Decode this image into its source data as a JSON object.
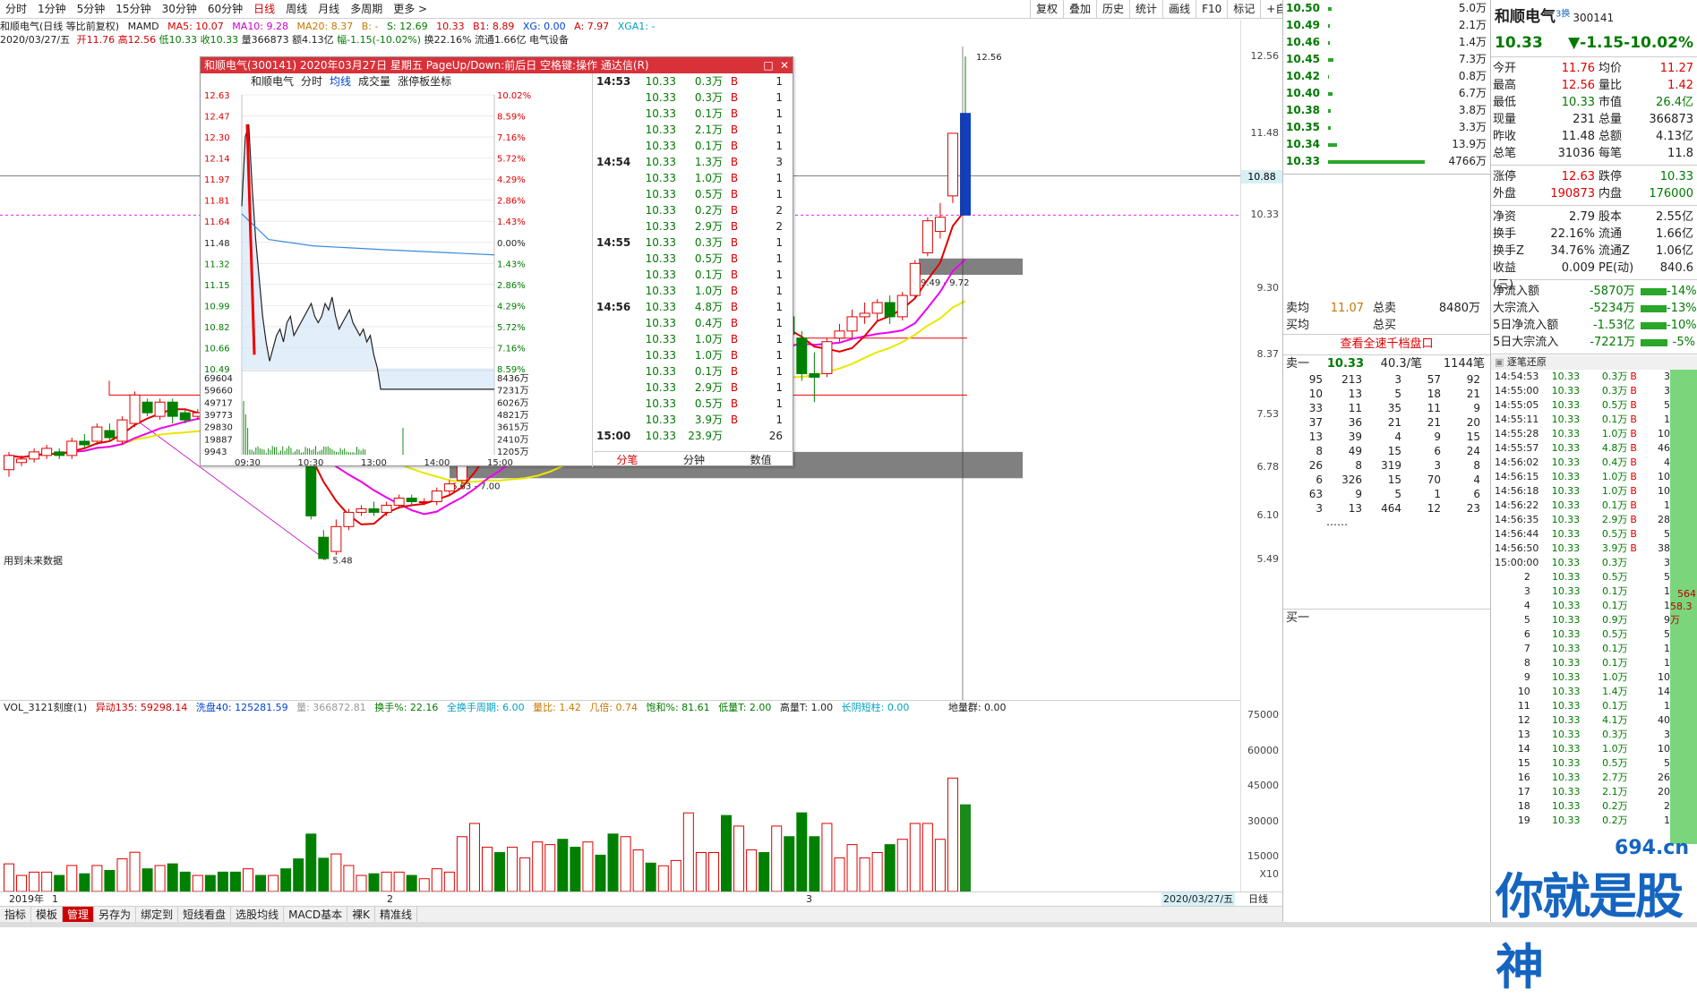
{
  "periods": [
    "分时",
    "1分钟",
    "5分钟",
    "15分钟",
    "30分钟",
    "60分钟",
    "日线",
    "周线",
    "月线",
    "多周期",
    "更多 >"
  ],
  "active_period": "日线",
  "tools": [
    "复权",
    "叠加",
    "历史",
    "统计",
    "画线",
    "F10",
    "标记",
    "+自选",
    "返回"
  ],
  "info": {
    "title": "和顺电气(日线 等比前复权)",
    "mamd": "MAMD",
    "ma5": "MA5: 10.07",
    "ma10": "MA10: 9.28",
    "ma20": "MA20: 8.37",
    "b_val": "B: -",
    "s_val": "S: 12.69",
    "sep": "10.33",
    "b1": "B1: 8.89",
    "xg": "XG: 0.00",
    "a": "A: 7.97",
    "xga1": "XGA1: -",
    "line2": "2020/03/27/五",
    "open": "开11.76",
    "high": "高12.56",
    "low": "低10.33",
    "close": "收10.33",
    "vol": "量366873",
    "amount": "额4.13亿",
    "pct": "幅-1.15(-10.02%)",
    "turnover": "换22.16%",
    "float": "流通1.66亿",
    "sector": "电气设备",
    "future_note": "用到未来数据"
  },
  "price_axis": [
    "12.56",
    "11.48",
    "10.88",
    "10.33",
    "9.30",
    "8.37",
    "7.53",
    "6.78",
    "6.10",
    "5.49"
  ],
  "kline_labels": {
    "high_mark": "12.56",
    "low_mark": "5.48",
    "zone1": "6.63 - 7.00",
    "zone2": "9.49 - 9.72"
  },
  "vol_header": {
    "name": "VOL_3121刻度(1)",
    "yidong": "异动135: 59298.14",
    "xipan": "洗盘40: 125281.59",
    "liang": "量: 366872.81",
    "huanshou": "换手%: 22.16",
    "quanzhou": "全换手周期: 6.00",
    "liangbi": "量比: 1.42",
    "jiliang": "几倍: 0.74",
    "baohe": "饱和%: 81.61",
    "dilian": "低量T: 2.00",
    "gaoliang": "高量T: 1.00",
    "changyin": "长阴短柱: 0.00",
    "diliangqun": "地量群: 0.00"
  },
  "vol_axis": [
    "75000",
    "60000",
    "45000",
    "30000",
    "15000",
    "X10"
  ],
  "date_bar": {
    "year": "2019年",
    "m1": "1",
    "m2": "2",
    "m3": "3",
    "current": "2020/03/27/五",
    "period": "日线"
  },
  "bottom_tabs": [
    "指标",
    "模板",
    "管理",
    "另存为",
    "绑定到",
    "短线看盘",
    "选股均线",
    "MACD基本",
    "裸K",
    "精准线"
  ],
  "active_bottom_tab": "管理",
  "popup": {
    "title": "和顺电气(300141) 2020年03月27日 星期五 PageUp/Down:前后日 空格键:操作 通达信(R)",
    "sub": [
      "和顺电气",
      "分时",
      "均线",
      "成交量",
      "涨停板坐标"
    ],
    "price_left": [
      "12.63",
      "12.47",
      "12.30",
      "12.14",
      "11.97",
      "11.81",
      "11.64",
      "11.48",
      "11.32",
      "11.15",
      "10.99",
      "10.82",
      "10.66",
      "10.49"
    ],
    "pct_right": [
      "10.02%",
      "8.59%",
      "7.16%",
      "5.72%",
      "4.29%",
      "2.86%",
      "1.43%",
      "0.00%",
      "1.43%",
      "2.86%",
      "4.29%",
      "5.72%",
      "7.16%",
      "8.59%"
    ],
    "vol_left": [
      "69604",
      "59660",
      "49717",
      "39773",
      "29830",
      "19887",
      "9943"
    ],
    "vol_right": [
      "8436万",
      "7231万",
      "6026万",
      "4821万",
      "3615万",
      "2410万",
      "1205万"
    ],
    "times": [
      "09:30",
      "10:30",
      "13:00",
      "14:00",
      "15:00"
    ],
    "trades": [
      {
        "t": "14:53",
        "p": "10.33",
        "v": "0.3万",
        "d": "B",
        "n": "1"
      },
      {
        "t": "",
        "p": "10.33",
        "v": "0.3万",
        "d": "B",
        "n": "1"
      },
      {
        "t": "",
        "p": "10.33",
        "v": "0.1万",
        "d": "B",
        "n": "1"
      },
      {
        "t": "",
        "p": "10.33",
        "v": "2.1万",
        "d": "B",
        "n": "1"
      },
      {
        "t": "",
        "p": "10.33",
        "v": "0.1万",
        "d": "B",
        "n": "1"
      },
      {
        "t": "14:54",
        "p": "10.33",
        "v": "1.3万",
        "d": "B",
        "n": "3"
      },
      {
        "t": "",
        "p": "10.33",
        "v": "1.0万",
        "d": "B",
        "n": "1"
      },
      {
        "t": "",
        "p": "10.33",
        "v": "0.5万",
        "d": "B",
        "n": "1"
      },
      {
        "t": "",
        "p": "10.33",
        "v": "0.2万",
        "d": "B",
        "n": "2"
      },
      {
        "t": "",
        "p": "10.33",
        "v": "2.9万",
        "d": "B",
        "n": "2"
      },
      {
        "t": "14:55",
        "p": "10.33",
        "v": "0.3万",
        "d": "B",
        "n": "1"
      },
      {
        "t": "",
        "p": "10.33",
        "v": "0.5万",
        "d": "B",
        "n": "1"
      },
      {
        "t": "",
        "p": "10.33",
        "v": "0.1万",
        "d": "B",
        "n": "1"
      },
      {
        "t": "",
        "p": "10.33",
        "v": "1.0万",
        "d": "B",
        "n": "1"
      },
      {
        "t": "14:56",
        "p": "10.33",
        "v": "4.8万",
        "d": "B",
        "n": "1"
      },
      {
        "t": "",
        "p": "10.33",
        "v": "0.4万",
        "d": "B",
        "n": "1"
      },
      {
        "t": "",
        "p": "10.33",
        "v": "1.0万",
        "d": "B",
        "n": "1"
      },
      {
        "t": "",
        "p": "10.33",
        "v": "1.0万",
        "d": "B",
        "n": "1"
      },
      {
        "t": "",
        "p": "10.33",
        "v": "0.1万",
        "d": "B",
        "n": "1"
      },
      {
        "t": "",
        "p": "10.33",
        "v": "2.9万",
        "d": "B",
        "n": "1"
      },
      {
        "t": "",
        "p": "10.33",
        "v": "0.5万",
        "d": "B",
        "n": "1"
      },
      {
        "t": "",
        "p": "10.33",
        "v": "3.9万",
        "d": "B",
        "n": "1"
      },
      {
        "t": "15:00",
        "p": "10.33",
        "v": "23.9万",
        "d": "",
        "n": "26"
      }
    ],
    "tabs": [
      "分笔",
      "分钟",
      "数值"
    ]
  },
  "order_book": [
    {
      "p": "10.50",
      "v": "5.0万",
      "w": 4
    },
    {
      "p": "10.49",
      "v": "2.1万",
      "w": 2
    },
    {
      "p": "10.46",
      "v": "1.4万",
      "w": 2
    },
    {
      "p": "10.45",
      "v": "7.3万",
      "w": 6
    },
    {
      "p": "10.42",
      "v": "0.8万",
      "w": 1
    },
    {
      "p": "10.40",
      "v": "6.7万",
      "w": 5
    },
    {
      "p": "10.38",
      "v": "3.8万",
      "w": 3
    },
    {
      "p": "10.35",
      "v": "3.3万",
      "w": 3
    },
    {
      "p": "10.34",
      "v": "13.9万",
      "w": 10
    },
    {
      "p": "10.33",
      "v": "4766万",
      "w": 108
    }
  ],
  "ob_mid": {
    "mj_k": "卖均",
    "mj_v": "11.07",
    "zm_k": "总卖",
    "zm_v": "8480万",
    "bj_k": "买均",
    "zb_k": "总买"
  },
  "link": "查看全速千档盘口",
  "sell1": {
    "k": "卖一",
    "p": "10.33",
    "v": "40.3/笔",
    "n": "1144笔"
  },
  "book_grid": [
    [
      "95",
      "213",
      "3",
      "57",
      "92"
    ],
    [
      "10",
      "13",
      "5",
      "18",
      "21"
    ],
    [
      "33",
      "11",
      "35",
      "11",
      "9"
    ],
    [
      "37",
      "36",
      "21",
      "21",
      "20"
    ],
    [
      "13",
      "39",
      "4",
      "9",
      "15"
    ],
    [
      "8",
      "49",
      "15",
      "6",
      "24"
    ],
    [
      "26",
      "8",
      "319",
      "3",
      "8"
    ],
    [
      "6",
      "326",
      "15",
      "70",
      "4"
    ],
    [
      "63",
      "9",
      "5",
      "1",
      "6"
    ],
    [
      "3",
      "13",
      "464",
      "12",
      "23"
    ]
  ],
  "book_more": "……",
  "buy1": "买一",
  "stock": {
    "name": "和顺电气",
    "code": "300141",
    "tag": "3换",
    "price": "10.33",
    "change": "▼-1.15-10.02%"
  },
  "stats": [
    [
      "今开",
      "11.76",
      "均价",
      "11.27"
    ],
    [
      "最高",
      "12.56",
      "量比",
      "1.42"
    ],
    [
      "最低",
      "10.33",
      "市值",
      "26.4亿"
    ],
    [
      "现量",
      "231",
      "总量",
      "366873"
    ],
    [
      "昨收",
      "11.48",
      "总额",
      "4.13亿"
    ],
    [
      "总笔",
      "31036",
      "每笔",
      "11.8"
    ]
  ],
  "stats2": [
    [
      "涨停",
      "12.63",
      "跌停",
      "10.33"
    ],
    [
      "外盘",
      "190873",
      "内盘",
      "176000"
    ]
  ],
  "stats3": [
    [
      "净资",
      "2.79",
      "股本",
      "2.55亿"
    ],
    [
      "换手",
      "22.16%",
      "流通",
      "1.66亿"
    ],
    [
      "换手Z",
      "34.76%",
      "流通Z",
      "1.06亿"
    ],
    [
      "收益(三)",
      "0.009",
      "PE(动)",
      "840.6"
    ]
  ],
  "flows": [
    {
      "k": "净流入额",
      "v": "-5870万",
      "p": "-14%"
    },
    {
      "k": "大宗流入",
      "v": "-5234万",
      "p": "-13%"
    },
    {
      "k": "5日净流入额",
      "v": "-1.53亿",
      "p": "-10%"
    },
    {
      "k": "5日大宗流入",
      "v": "-7221万",
      "p": "-5%"
    }
  ],
  "tick_title": "逐笔还原",
  "ticks": [
    {
      "t": "14:54:53",
      "p": "10.33",
      "v": "0.3万",
      "d": "B",
      "n": "3"
    },
    {
      "t": "14:55:00",
      "p": "10.33",
      "v": "0.3万",
      "d": "B",
      "n": "3"
    },
    {
      "t": "14:55:05",
      "p": "10.33",
      "v": "0.5万",
      "d": "B",
      "n": "5"
    },
    {
      "t": "14:55:11",
      "p": "10.33",
      "v": "0.1万",
      "d": "B",
      "n": "1"
    },
    {
      "t": "14:55:28",
      "p": "10.33",
      "v": "1.0万",
      "d": "B",
      "n": "10"
    },
    {
      "t": "14:55:57",
      "p": "10.33",
      "v": "4.8万",
      "d": "B",
      "n": "46"
    },
    {
      "t": "14:56:02",
      "p": "10.33",
      "v": "0.4万",
      "d": "B",
      "n": "4"
    },
    {
      "t": "14:56:15",
      "p": "10.33",
      "v": "1.0万",
      "d": "B",
      "n": "10"
    },
    {
      "t": "14:56:18",
      "p": "10.33",
      "v": "1.0万",
      "d": "B",
      "n": "10"
    },
    {
      "t": "14:56:22",
      "p": "10.33",
      "v": "0.1万",
      "d": "B",
      "n": "1"
    },
    {
      "t": "14:56:35",
      "p": "10.33",
      "v": "2.9万",
      "d": "B",
      "n": "28"
    },
    {
      "t": "14:56:44",
      "p": "10.33",
      "v": "0.5万",
      "d": "B",
      "n": "5"
    },
    {
      "t": "14:56:50",
      "p": "10.33",
      "v": "3.9万",
      "d": "B",
      "n": "38"
    },
    {
      "t": "15:00:00",
      "p": "10.33",
      "v": "0.3万",
      "d": "",
      "n": "3"
    },
    {
      "t": "2",
      "p": "10.33",
      "v": "0.5万",
      "d": "",
      "n": "5"
    },
    {
      "t": "3",
      "p": "10.33",
      "v": "0.1万",
      "d": "",
      "n": "1"
    },
    {
      "t": "4",
      "p": "10.33",
      "v": "0.1万",
      "d": "",
      "n": "1"
    },
    {
      "t": "5",
      "p": "10.33",
      "v": "0.9万",
      "d": "",
      "n": "9"
    },
    {
      "t": "6",
      "p": "10.33",
      "v": "0.5万",
      "d": "",
      "n": "5"
    },
    {
      "t": "7",
      "p": "10.33",
      "v": "0.1万",
      "d": "",
      "n": "1"
    },
    {
      "t": "8",
      "p": "10.33",
      "v": "0.1万",
      "d": "",
      "n": "1"
    },
    {
      "t": "9",
      "p": "10.33",
      "v": "1.0万",
      "d": "",
      "n": "10"
    },
    {
      "t": "10",
      "p": "10.33",
      "v": "1.4万",
      "d": "",
      "n": "14"
    },
    {
      "t": "11",
      "p": "10.33",
      "v": "0.1万",
      "d": "",
      "n": "1"
    },
    {
      "t": "12",
      "p": "10.33",
      "v": "4.1万",
      "d": "",
      "n": "40"
    },
    {
      "t": "13",
      "p": "10.33",
      "v": "0.3万",
      "d": "",
      "n": "3"
    },
    {
      "t": "14",
      "p": "10.33",
      "v": "1.0万",
      "d": "",
      "n": "10"
    },
    {
      "t": "15",
      "p": "10.33",
      "v": "0.5万",
      "d": "",
      "n": "5"
    },
    {
      "t": "16",
      "p": "10.33",
      "v": "2.7万",
      "d": "",
      "n": "26"
    },
    {
      "t": "17",
      "p": "10.33",
      "v": "2.1万",
      "d": "",
      "n": "20"
    },
    {
      "t": "18",
      "p": "10.33",
      "v": "0.2万",
      "d": "",
      "n": "2"
    },
    {
      "t": "19",
      "p": "10.33",
      "v": "0.2万",
      "d": "",
      "n": "1"
    }
  ],
  "side_bar": {
    "n1": "564",
    "n2": "58.3万"
  },
  "watermark": {
    "small": "694.cn",
    "big": "你就是股神"
  },
  "colors": {
    "up": "#e00000",
    "down": "#008000",
    "ma5": "#e00000",
    "ma10": "#ee00ee",
    "ma20": "#e8e800",
    "accent": "#d9313a"
  },
  "chart_data": {
    "type": "candlestick",
    "title": "和顺电气(日线 等比前复权)",
    "ylim": [
      5.4,
      12.7
    ],
    "candles": [
      {
        "o": 6.75,
        "c": 6.95,
        "h": 7.0,
        "l": 6.65
      },
      {
        "o": 6.85,
        "c": 6.9,
        "h": 6.95,
        "l": 6.8
      },
      {
        "o": 6.9,
        "c": 7.0,
        "h": 7.05,
        "l": 6.85
      },
      {
        "o": 6.95,
        "c": 7.05,
        "h": 7.1,
        "l": 6.9
      },
      {
        "o": 7.0,
        "c": 6.95,
        "h": 7.05,
        "l": 6.9
      },
      {
        "o": 6.95,
        "c": 7.15,
        "h": 7.2,
        "l": 6.9
      },
      {
        "o": 7.15,
        "c": 7.1,
        "h": 7.25,
        "l": 7.05
      },
      {
        "o": 7.15,
        "c": 7.35,
        "h": 7.4,
        "l": 7.1
      },
      {
        "o": 7.3,
        "c": 7.2,
        "h": 7.4,
        "l": 7.15
      },
      {
        "o": 7.15,
        "c": 7.45,
        "h": 7.5,
        "l": 7.1
      },
      {
        "o": 7.4,
        "c": 7.8,
        "h": 7.85,
        "l": 7.35
      },
      {
        "o": 7.7,
        "c": 7.55,
        "h": 7.75,
        "l": 7.5
      },
      {
        "o": 7.5,
        "c": 7.7,
        "h": 7.75,
        "l": 7.45
      },
      {
        "o": 7.7,
        "c": 7.5,
        "h": 7.75,
        "l": 7.4
      },
      {
        "o": 7.55,
        "c": 7.45,
        "h": 7.6,
        "l": 7.4
      },
      {
        "o": 7.5,
        "c": 7.55,
        "h": 7.6,
        "l": 7.45
      },
      {
        "o": 7.45,
        "c": 7.4,
        "h": 7.5,
        "l": 7.35
      },
      {
        "o": 7.4,
        "c": 7.3,
        "h": 7.45,
        "l": 7.25
      },
      {
        "o": 7.3,
        "c": 7.2,
        "h": 7.35,
        "l": 7.15
      },
      {
        "o": 7.2,
        "c": 7.35,
        "h": 7.4,
        "l": 7.15
      },
      {
        "o": 7.3,
        "c": 7.25,
        "h": 7.35,
        "l": 7.2
      },
      {
        "o": 7.25,
        "c": 7.3,
        "h": 7.35,
        "l": 7.2
      },
      {
        "o": 7.3,
        "c": 7.15,
        "h": 7.35,
        "l": 7.1
      },
      {
        "o": 7.15,
        "c": 6.85,
        "h": 7.2,
        "l": 6.8
      },
      {
        "o": 6.8,
        "c": 6.1,
        "h": 6.8,
        "l": 6.05
      },
      {
        "o": 5.8,
        "c": 5.5,
        "h": 5.9,
        "l": 5.48
      },
      {
        "o": 5.6,
        "c": 5.95,
        "h": 6.05,
        "l": 5.55
      },
      {
        "o": 5.95,
        "c": 6.15,
        "h": 6.2,
        "l": 5.9
      },
      {
        "o": 6.15,
        "c": 6.2,
        "h": 6.25,
        "l": 6.1
      },
      {
        "o": 6.2,
        "c": 6.15,
        "h": 6.3,
        "l": 6.1
      },
      {
        "o": 6.15,
        "c": 6.25,
        "h": 6.3,
        "l": 6.1
      },
      {
        "o": 6.25,
        "c": 6.35,
        "h": 6.4,
        "l": 6.2
      },
      {
        "o": 6.35,
        "c": 6.3,
        "h": 6.4,
        "l": 6.25
      },
      {
        "o": 6.3,
        "c": 6.3,
        "h": 6.35,
        "l": 6.25
      },
      {
        "o": 6.3,
        "c": 6.45,
        "h": 6.5,
        "l": 6.25
      },
      {
        "o": 6.45,
        "c": 6.55,
        "h": 6.6,
        "l": 6.4
      },
      {
        "o": 6.6,
        "c": 6.9,
        "h": 7.0,
        "l": 6.55
      },
      {
        "o": 6.9,
        "c": 7.35,
        "h": 7.4,
        "l": 6.85
      },
      {
        "o": 7.4,
        "c": 7.6,
        "h": 7.65,
        "l": 7.3
      },
      {
        "o": 7.45,
        "c": 7.3,
        "h": 7.55,
        "l": 7.25
      },
      {
        "o": 7.4,
        "c": 7.6,
        "h": 7.7,
        "l": 7.35
      },
      {
        "o": 7.55,
        "c": 7.6,
        "h": 7.8,
        "l": 7.5
      },
      {
        "o": 7.6,
        "c": 7.85,
        "h": 7.95,
        "l": 7.55
      },
      {
        "o": 7.8,
        "c": 8.0,
        "h": 8.1,
        "l": 7.7
      },
      {
        "o": 8.0,
        "c": 7.7,
        "h": 8.05,
        "l": 7.65
      },
      {
        "o": 7.7,
        "c": 7.5,
        "h": 7.75,
        "l": 7.4
      },
      {
        "o": 7.5,
        "c": 7.75,
        "h": 7.85,
        "l": 7.45
      },
      {
        "o": 7.75,
        "c": 7.6,
        "h": 7.8,
        "l": 7.55
      },
      {
        "o": 7.6,
        "c": 7.25,
        "h": 7.65,
        "l": 7.2
      },
      {
        "o": 7.2,
        "c": 7.5,
        "h": 7.6,
        "l": 7.15
      },
      {
        "o": 7.5,
        "c": 7.7,
        "h": 7.75,
        "l": 7.45
      },
      {
        "o": 7.6,
        "c": 7.55,
        "h": 7.7,
        "l": 7.5
      },
      {
        "o": 7.55,
        "c": 7.6,
        "h": 7.65,
        "l": 7.5
      },
      {
        "o": 7.6,
        "c": 7.7,
        "h": 7.75,
        "l": 7.55
      },
      {
        "o": 7.7,
        "c": 8.25,
        "h": 8.3,
        "l": 7.65
      },
      {
        "o": 8.25,
        "c": 8.4,
        "h": 8.5,
        "l": 8.2
      },
      {
        "o": 8.4,
        "c": 8.55,
        "h": 8.6,
        "l": 8.3
      },
      {
        "o": 8.55,
        "c": 8.35,
        "h": 9.15,
        "l": 8.2
      },
      {
        "o": 8.35,
        "c": 8.6,
        "h": 8.7,
        "l": 8.0
      },
      {
        "o": 8.6,
        "c": 8.75,
        "h": 8.85,
        "l": 8.5
      },
      {
        "o": 8.75,
        "c": 8.7,
        "h": 9.0,
        "l": 8.6
      },
      {
        "o": 8.7,
        "c": 8.9,
        "h": 9.3,
        "l": 8.55
      },
      {
        "o": 8.9,
        "c": 8.65,
        "h": 9.1,
        "l": 8.6
      },
      {
        "o": 8.6,
        "c": 8.1,
        "h": 8.7,
        "l": 8.0
      },
      {
        "o": 8.1,
        "c": 8.05,
        "h": 8.4,
        "l": 7.7
      },
      {
        "o": 8.1,
        "c": 8.55,
        "h": 8.6,
        "l": 8.05
      },
      {
        "o": 8.6,
        "c": 8.7,
        "h": 8.8,
        "l": 8.55
      },
      {
        "o": 8.7,
        "c": 8.9,
        "h": 9.0,
        "l": 8.6
      },
      {
        "o": 8.9,
        "c": 8.95,
        "h": 9.1,
        "l": 8.8
      },
      {
        "o": 8.95,
        "c": 9.1,
        "h": 9.15,
        "l": 8.85
      },
      {
        "o": 9.1,
        "c": 8.9,
        "h": 9.2,
        "l": 8.8
      },
      {
        "o": 8.9,
        "c": 9.2,
        "h": 9.25,
        "l": 8.85
      },
      {
        "o": 9.2,
        "c": 9.65,
        "h": 9.7,
        "l": 9.15
      },
      {
        "o": 9.8,
        "c": 10.25,
        "h": 10.3,
        "l": 9.75
      },
      {
        "o": 10.1,
        "c": 10.3,
        "h": 10.5,
        "l": 10.0
      },
      {
        "o": 10.6,
        "c": 11.48,
        "h": 11.48,
        "l": 10.5
      },
      {
        "o": 11.76,
        "c": 10.33,
        "h": 12.56,
        "l": 10.33
      }
    ],
    "volume_scale": [
      0,
      75000
    ]
  }
}
